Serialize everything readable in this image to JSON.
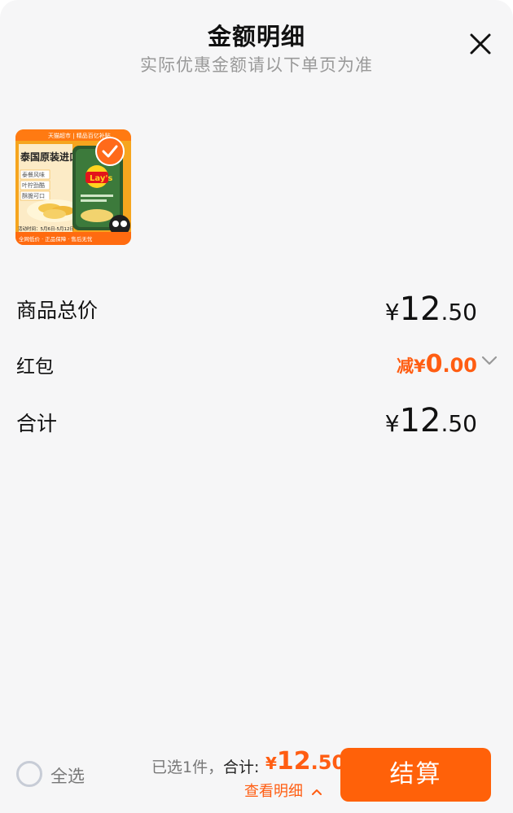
{
  "header": {
    "title": "金额明细",
    "subtitle": "实际优惠金额请以下单页为准"
  },
  "product": {
    "image_text": {
      "top_banner": "天猫超市 | 精品百亿补贴",
      "headline": "泰国原装进口",
      "features": [
        "泰餐风味",
        "叶柠劲酷",
        "酥脆可口"
      ],
      "activity": "活动时间：5月6日-5月12日",
      "footer": "全网低价 · 正品保障 · 售后无忧",
      "brand": "Lay's"
    }
  },
  "summary": {
    "total_price_label": "商品总价",
    "total_price": {
      "yen": "¥",
      "int": "12",
      "dec": ".50"
    },
    "red_packet_label": "红包",
    "red_packet": {
      "prefix": "减",
      "yen": "¥",
      "int": "0",
      "dec": ".00"
    },
    "grand_total_label": "合计",
    "grand_total": {
      "yen": "¥",
      "int": "12",
      "dec": ".50"
    }
  },
  "bottom_bar": {
    "select_all": "全选",
    "selected_count": "已选1件，",
    "total_label": "合计:",
    "total": {
      "yen": "¥",
      "int": "12",
      "dec": ".50"
    },
    "view_detail": "查看明细",
    "checkout": "结算"
  },
  "colors": {
    "accent": "#ff6109",
    "price_highlight": "#ff5d12",
    "background": "#f6f6f7"
  }
}
